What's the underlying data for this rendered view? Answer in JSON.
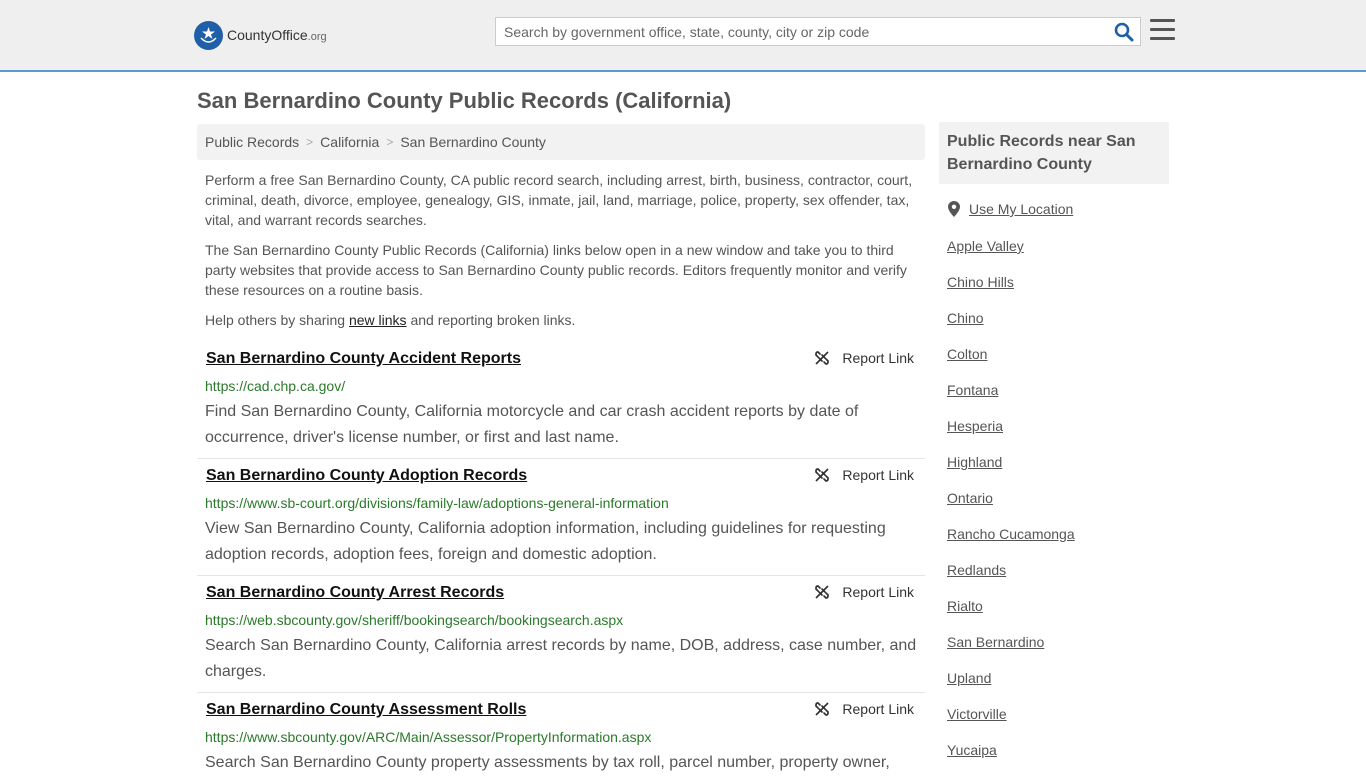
{
  "header": {
    "logo_main": "CountyOffice",
    "logo_suffix": ".org",
    "search_placeholder": "Search by government office, state, county, city or zip code"
  },
  "page": {
    "title": "San Bernardino County Public Records (California)"
  },
  "breadcrumb": [
    "Public Records",
    "California",
    "San Bernardino County"
  ],
  "intro": {
    "p1": "Perform a free San Bernardino County, CA public record search, including arrest, birth, business, contractor, court, criminal, death, divorce, employee, genealogy, GIS, inmate, jail, land, marriage, police, property, sex offender, tax, vital, and warrant records searches.",
    "p2": "The San Bernardino County Public Records (California) links below open in a new window and take you to third party websites that provide access to San Bernardino County public records. Editors frequently monitor and verify these resources on a routine basis.",
    "p3_before": "Help others by sharing ",
    "p3_link": "new links",
    "p3_after": " and reporting broken links."
  },
  "records": [
    {
      "title": "San Bernardino County Accident Reports",
      "url": "https://cad.chp.ca.gov/",
      "description": "Find San Bernardino County, California motorcycle and car crash accident reports by date of occurrence, driver's license number, or first and last name.",
      "report_label": "Report Link"
    },
    {
      "title": "San Bernardino County Adoption Records",
      "url": "https://www.sb-court.org/divisions/family-law/adoptions-general-information",
      "description": "View San Bernardino County, California adoption information, including guidelines for requesting adoption records, adoption fees, foreign and domestic adoption.",
      "report_label": "Report Link"
    },
    {
      "title": "San Bernardino County Arrest Records",
      "url": "https://web.sbcounty.gov/sheriff/bookingsearch/bookingsearch.aspx",
      "description": "Search San Bernardino County, California arrest records by name, DOB, address, case number, and charges.",
      "report_label": "Report Link"
    },
    {
      "title": "San Bernardino County Assessment Rolls",
      "url": "https://www.sbcounty.gov/ARC/Main/Assessor/PropertyInformation.aspx",
      "description": "Search San Bernardino County property assessments by tax roll, parcel number, property owner,",
      "report_label": "Report Link"
    }
  ],
  "sidebar": {
    "heading": "Public Records near San Bernardino County",
    "use_location": "Use My Location",
    "cities": [
      "Apple Valley",
      "Chino Hills",
      "Chino",
      "Colton",
      "Fontana",
      "Hesperia",
      "Highland",
      "Ontario",
      "Rancho Cucamonga",
      "Redlands",
      "Rialto",
      "San Bernardino",
      "Upland",
      "Victorville",
      "Yucaipa"
    ]
  },
  "colors": {
    "accent": "#1f5fa8",
    "url_green": "#2b7a2b",
    "header_bg": "#efefef"
  }
}
